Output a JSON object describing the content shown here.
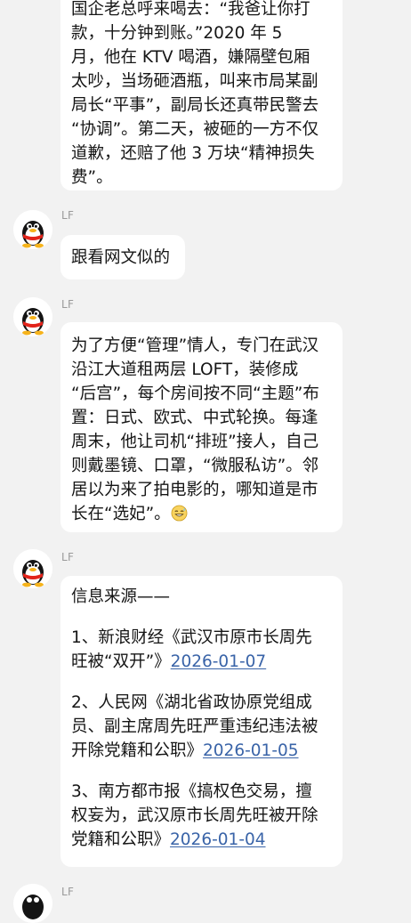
{
  "messages": [
    {
      "sender": "",
      "lines": [
        "国企老总呼来喝去：“我爸让你打",
        "款，十分钟到账。”2020 年 5",
        "月，他在 KTV 喝酒，嫌隔壁包厢",
        "太吵，当场砸酒瓶，叫来市局某副",
        "局长“平事”，副局长还真带民警去",
        "“协调”。第二天，被砸的一方不仅",
        "道歉，还赔了他 3 万块“精神损失",
        "费”。"
      ]
    },
    {
      "sender": "LF",
      "lines": [
        "跟看网文似的"
      ]
    },
    {
      "sender": "LF",
      "lines": [
        "为了方便“管理”情人，专门在武汉",
        "沿江大道租两层 LOFT，装修成",
        "“后宫”，每个房间按不同“主题”布",
        "置：日式、欧式、中式轮换。每逢",
        "周末，他让司机“排班”接人，自己",
        "则戴墨镜、口罩，“微服私访”。邻",
        "居以为来了拍电影的，哪知道是市",
        "长在“选妃”。"
      ],
      "trailing_emoji": "grin-sweat-emoji"
    },
    {
      "sender": "LF",
      "heading": "信息来源——",
      "sources": [
        {
          "lines": [
            "1、新浪财经《武汉市原市长周先",
            "旺被“双开”》"
          ],
          "link": "2026-01-07"
        },
        {
          "lines": [
            "2、人民网《湖北省政协原党组成",
            "员、副主席周先旺严重违纪违法被",
            "开除党籍和公职》"
          ],
          "link": "2026-01-05"
        },
        {
          "lines": [
            "3、南方都市报《搞权色交易，擅",
            "权妄为，武汉原市长周先旺被开除",
            "党籍和公职》"
          ],
          "link": "2026-01-04"
        }
      ]
    },
    {
      "sender": "LF"
    }
  ],
  "colors": {
    "background": "#f2f2f2",
    "bubble": "#ffffff",
    "text": "#151515",
    "link": "#3a64a8",
    "sender": "#9a9a9a"
  },
  "icons": {
    "avatar": "qq-penguin-avatar-icon"
  }
}
